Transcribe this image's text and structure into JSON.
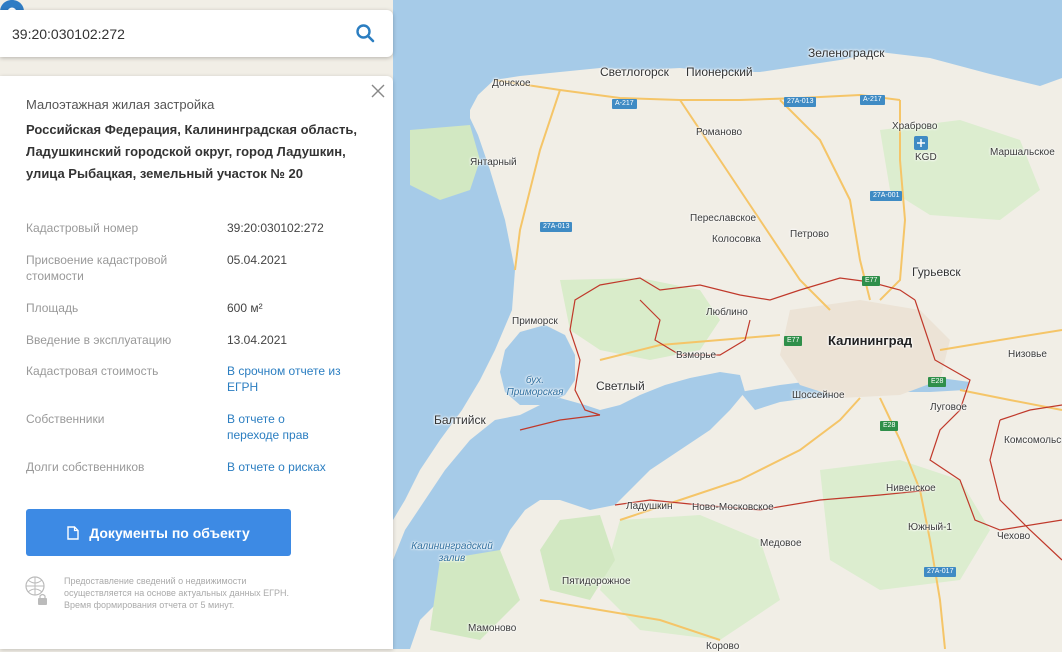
{
  "search": {
    "value": "39:20:030102:272"
  },
  "panel": {
    "type": "Малоэтажная жилая застройка",
    "address": "Российская Федерация, Калининградская область, Ладушкинский городской округ, город Ладушкин, улица Рыбацкая, земельный участок № 20",
    "rows": [
      {
        "key": "Кадастровый номер",
        "value": "39:20:030102:272"
      },
      {
        "key": "Присвоение кадастровой стоимости",
        "value": "05.04.2021"
      },
      {
        "key": "Площадь",
        "value": "600 м²"
      },
      {
        "key": "Введение в эксплуатацию",
        "value": "13.04.2021"
      },
      {
        "key": "Кадастровая стоимость",
        "value": "В срочном отчете из ЕГРН"
      },
      {
        "key": "Собственники",
        "value": "В отчете о переходе прав"
      },
      {
        "key": "Долги собственников",
        "value": "В отчете о рисках"
      }
    ],
    "button": "Документы по объекту",
    "note": "Предоставление сведений о недвижимости осуществляется на основе актуальных данных ЕГРН. Время формирования отчета от 5 минут."
  },
  "map": {
    "labels": {
      "zelenogradsk": "Зеленоградск",
      "svetlogorsk": "Светлогорск",
      "pionersky": "Пионерский",
      "donskoe": "Донское",
      "romanovo": "Романово",
      "khrabrovo": "Храброво",
      "kgd": "KGD",
      "marshalskoe": "Маршальское",
      "yantarny": "Янтарный",
      "pereslavskoe": "Переславское",
      "kolosovka": "Колосовка",
      "petrovo": "Петрово",
      "guryevsk": "Гурьевск",
      "primorsk": "Приморск",
      "lyublino": "Люблино",
      "kaliningrad": "Калининград",
      "nizovye": "Низовье",
      "vzmorye": "Взморье",
      "svetly": "Светлый",
      "bay": "бух. Приморская",
      "baltiysk": "Балтийск",
      "shosseynoe": "Шоссейное",
      "lugovoe": "Луговое",
      "komsomolsk": "Комсомольск",
      "ladushkin": "Ладушкин",
      "novomoskovskoe": "Ново-Московское",
      "nivenskoe": "Нивенское",
      "yuzhny": "Южный-1",
      "chekhovo": "Чехово",
      "medovoe": "Медовое",
      "lagoon": "Калининградский залив",
      "pyatidorozhnoe": "Пятидорожное",
      "mamonovo": "Мамоново",
      "korovo": "Корово"
    },
    "shields": {
      "a217a": "A-217",
      "r27a013a": "27A-013",
      "a217b": "A-217",
      "r27a001": "27A-001",
      "r27a013b": "27A-013",
      "e77a": "E77",
      "e77b": "E77",
      "e28a": "E28",
      "e28b": "E28",
      "r27a017": "27A-017"
    },
    "colors": {
      "water": "#a6cbe8",
      "land": "#f1eee6",
      "green": "#d2e8c2",
      "border": "#c0392b",
      "road": "#f5c568",
      "pin": "#2f7cc4"
    }
  }
}
